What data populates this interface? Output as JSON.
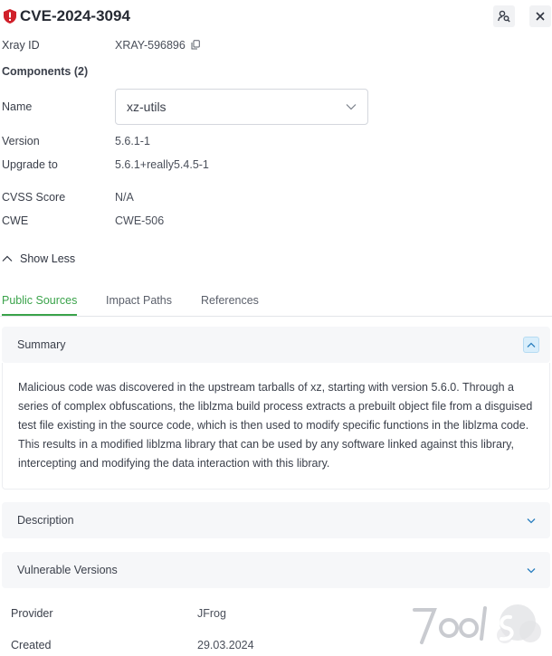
{
  "header": {
    "title": "CVE-2024-3094",
    "severity_color": "#d0202a",
    "search_icon": "person-search-icon",
    "close_icon": "close-icon"
  },
  "details": {
    "xray_id_label": "Xray ID",
    "xray_id_value": "XRAY-596896",
    "copy_icon": "copy-icon",
    "components_label": "Components (2)",
    "name_label": "Name",
    "name_value": "xz-utils",
    "version_label": "Version",
    "version_value": "5.6.1-1",
    "upgrade_label": "Upgrade to",
    "upgrade_value": "5.6.1+really5.4.5-1",
    "cvss_label": "CVSS Score",
    "cvss_value": "N/A",
    "cwe_label": "CWE",
    "cwe_value": "CWE-506",
    "show_less_label": "Show Less"
  },
  "tabs": [
    {
      "label": "Public Sources",
      "active": true
    },
    {
      "label": "Impact Paths",
      "active": false
    },
    {
      "label": "References",
      "active": false
    }
  ],
  "panels": {
    "summary": {
      "title": "Summary",
      "text": "Malicious code was discovered in the upstream tarballs of xz, starting with version 5.6.0. Through a series of complex obfuscations, the liblzma build process extracts a prebuilt object file from a disguised test file existing in the source code, which is then used to modify specific functions in the liblzma code. This results in a modified liblzma library that can be used by any software linked against this library, intercepting and modifying the data interaction with this library."
    },
    "description": {
      "title": "Description"
    },
    "vulnerable_versions": {
      "title": "Vulnerable Versions"
    }
  },
  "info": {
    "provider_label": "Provider",
    "provider_value": "JFrog",
    "created_label": "Created",
    "created_value": "29.03.2024"
  },
  "colors": {
    "accent": "#3aa34a",
    "toggle_bg": "#d9eefb",
    "panel_bg": "#f6f7f9"
  }
}
